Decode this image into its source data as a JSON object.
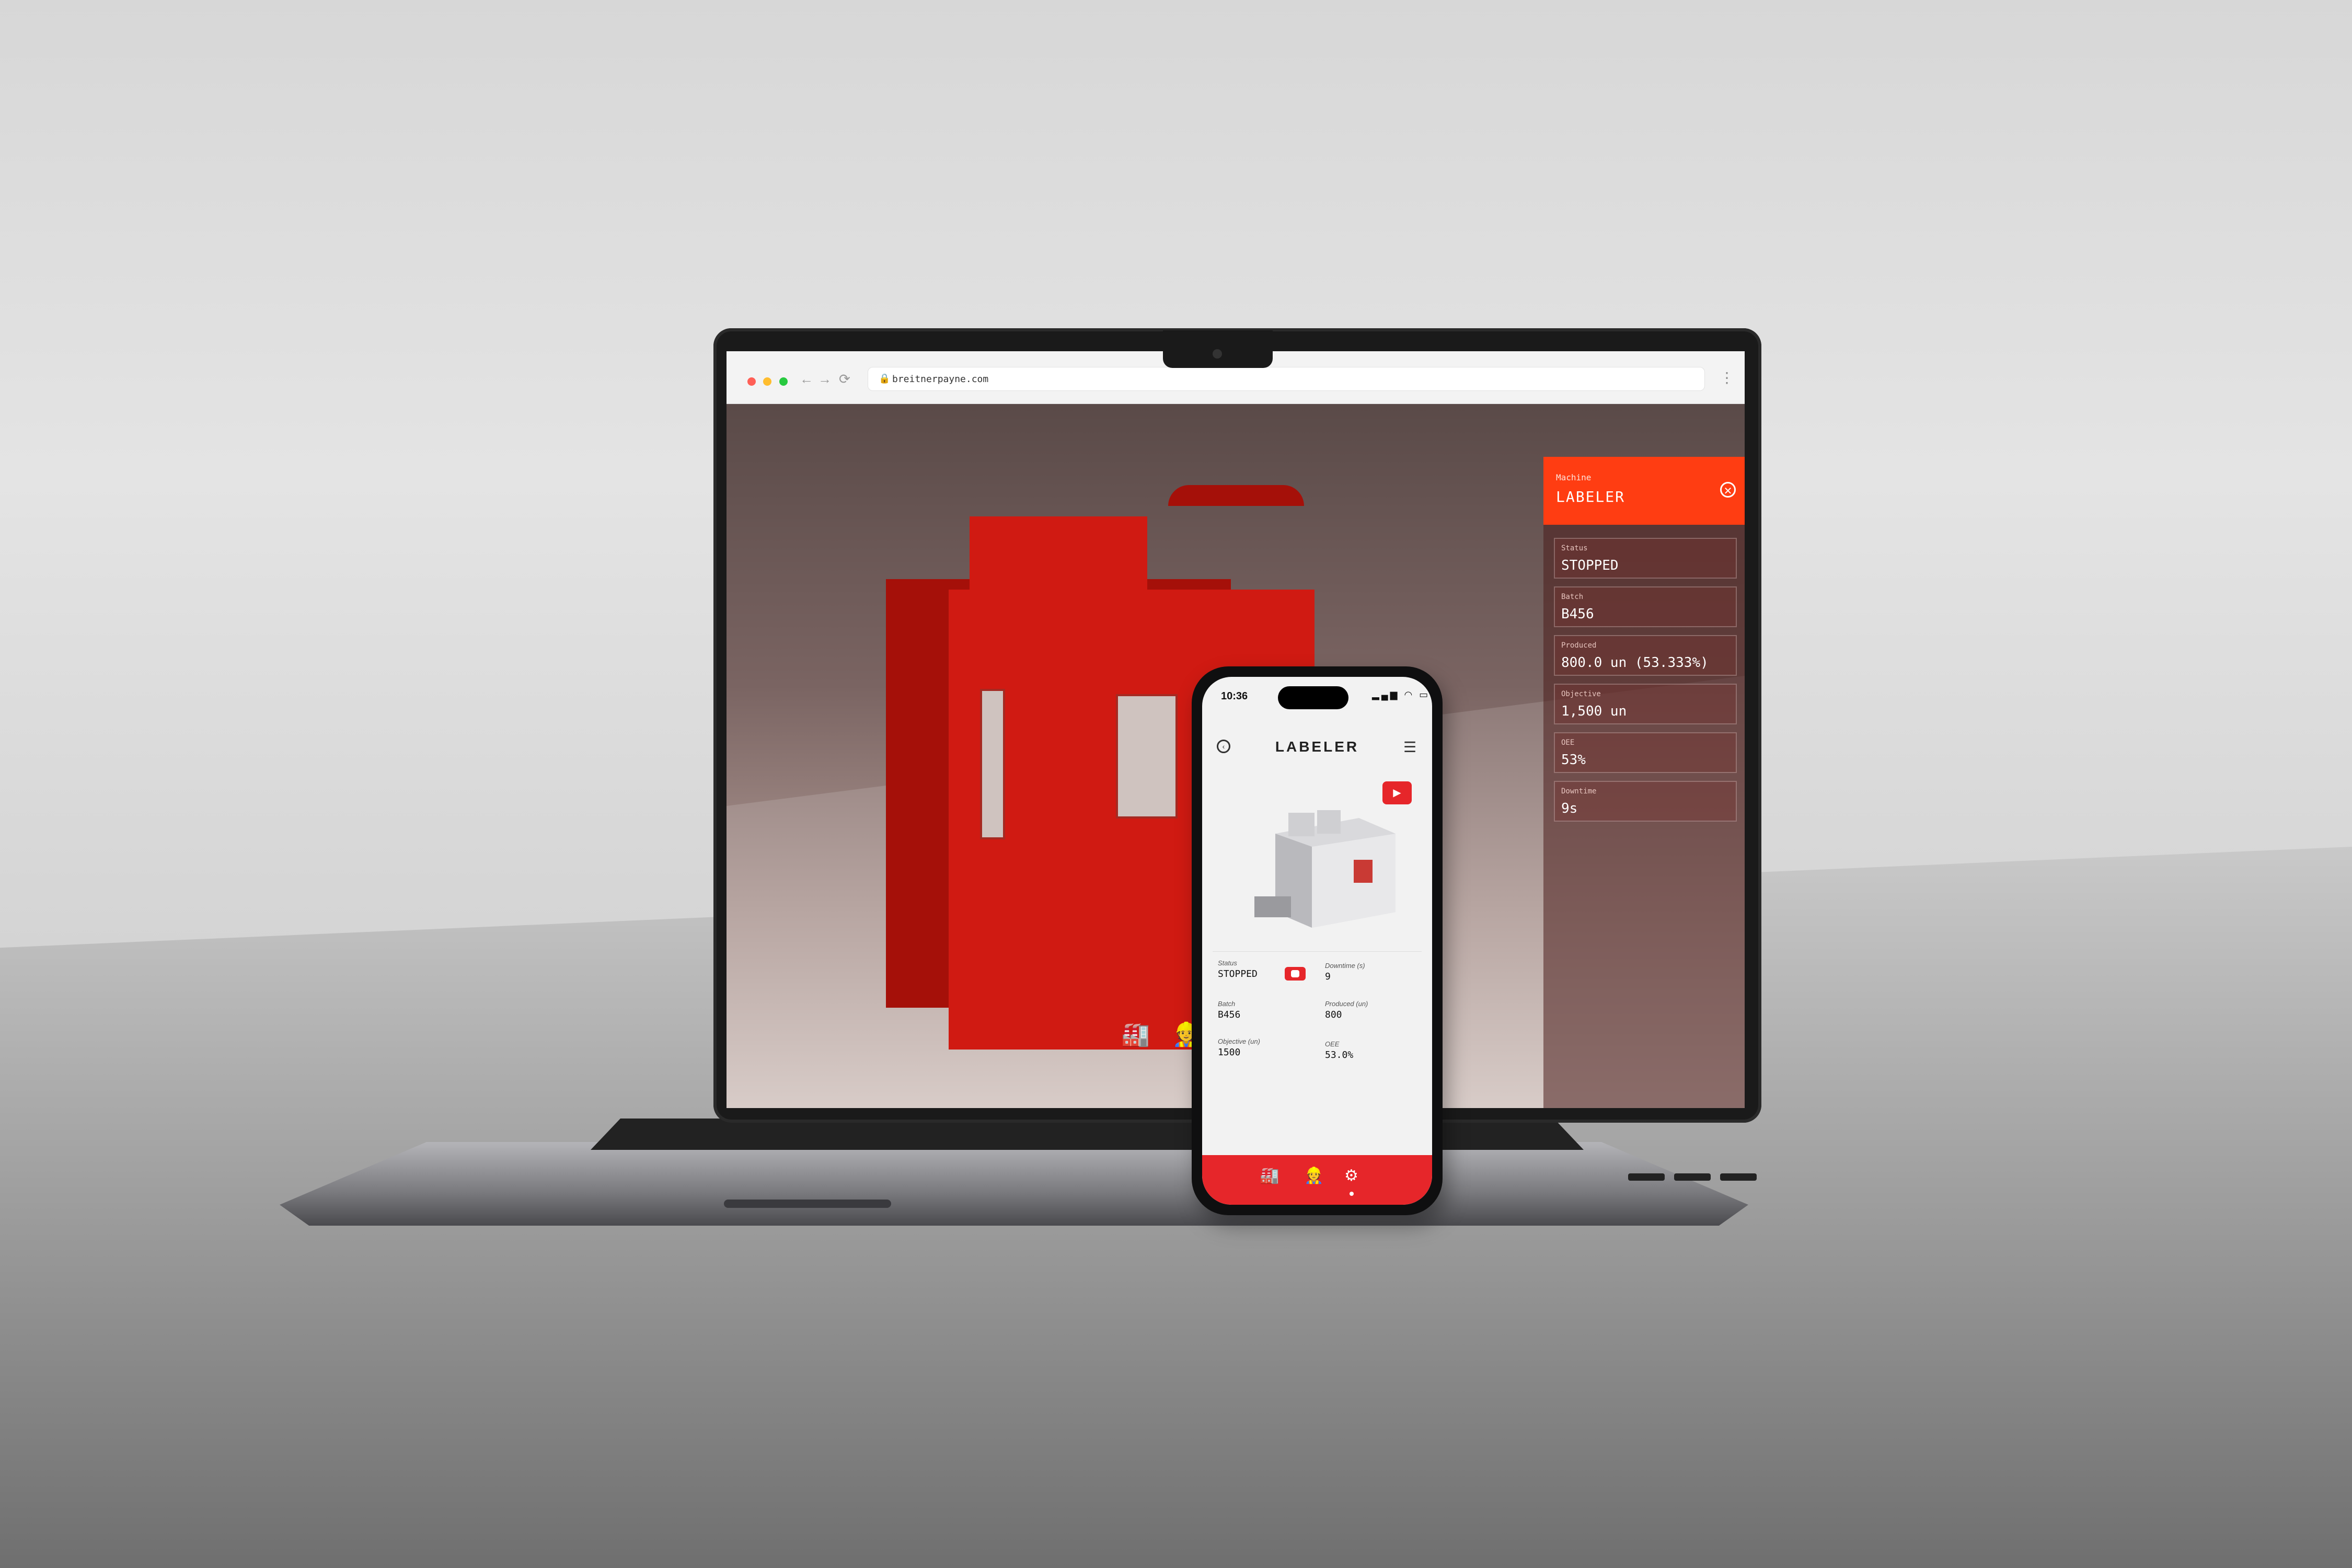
{
  "browser": {
    "url": "breitnerpayne.com",
    "back_icon": "←",
    "forward_icon": "→",
    "reload_icon": "⟳",
    "menu_icon": "⋮",
    "traffic_lights": [
      "#ff5f56",
      "#ffbd2e",
      "#27c93f"
    ]
  },
  "dashboard": {
    "section_label": "Machine",
    "machine_name": "LABELER",
    "close_icon": "✕",
    "cards": [
      {
        "label": "Status",
        "value": "STOPPED"
      },
      {
        "label": "Batch",
        "value": "B456"
      },
      {
        "label": "Produced",
        "value": "800.0 un (53.333%)"
      },
      {
        "label": "Objective",
        "value": "1,500 un"
      },
      {
        "label": "OEE",
        "value": "53%"
      },
      {
        "label": "Downtime",
        "value": "9s"
      }
    ],
    "dock_icons": [
      "🏭",
      "👷"
    ]
  },
  "phone": {
    "time": "10:36",
    "status_icons": "▂▄▆ ◠ ▭",
    "title": "LABELER",
    "back_icon": "‹",
    "menu_icon": "☰",
    "camera_icon": "▶",
    "stats": {
      "status_label": "Status",
      "status_value": "STOPPED",
      "downtime_label": "Downtime (s)",
      "downtime_value": "9",
      "batch_label": "Batch",
      "batch_value": "B456",
      "produced_label": "Produced (un)",
      "produced_value": "800",
      "objective_label": "Objective (un)",
      "objective_value": "1500",
      "oee_label": "OEE",
      "oee_value": "53.0%"
    },
    "tabs": [
      "🏭",
      "👷",
      "⚙"
    ]
  },
  "colors": {
    "accent": "#ff3d12",
    "machine_red": "#d01a12",
    "mobile_accent": "#e6262a"
  }
}
